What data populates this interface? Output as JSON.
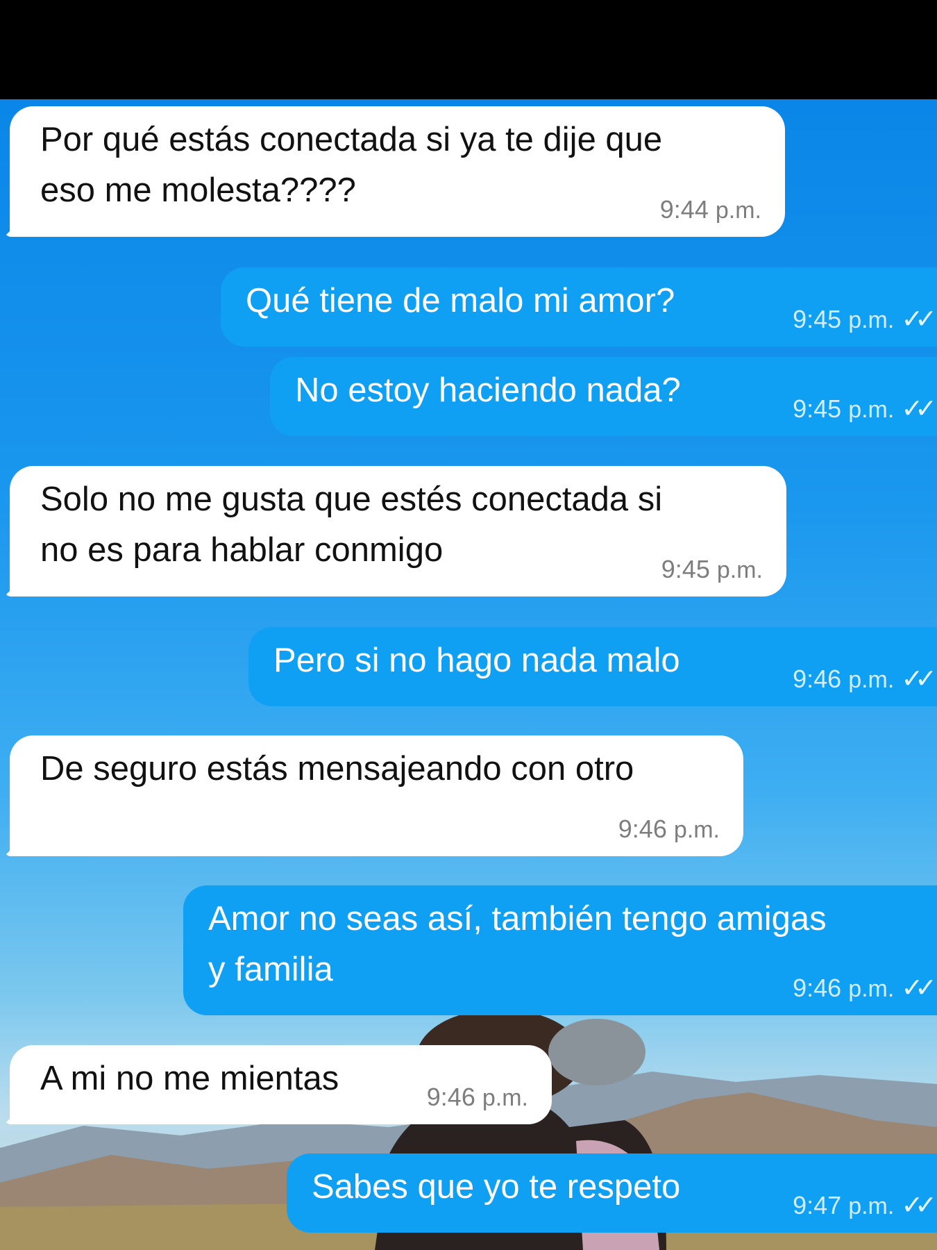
{
  "colors": {
    "incoming_bubble": "#ffffff",
    "outgoing_bubble": "#0fa0f3",
    "wallpaper": "#0a86e8"
  },
  "messages": [
    {
      "direction": "incoming",
      "text_lines": [
        "Por qué estás conectada si ya te dije que",
        "eso me molesta????"
      ],
      "time": "9:44",
      "ampm": "p.m."
    },
    {
      "direction": "outgoing",
      "text_lines": [
        "Qué tiene de malo mi amor?"
      ],
      "time": "9:45",
      "ampm": "p.m.",
      "status_icon": "double-check-icon"
    },
    {
      "direction": "outgoing",
      "text_lines": [
        "No estoy haciendo nada?"
      ],
      "time": "9:45",
      "ampm": "p.m.",
      "status_icon": "double-check-icon"
    },
    {
      "direction": "incoming",
      "text_lines": [
        "Solo no me gusta que estés conectada si",
        "no es para hablar conmigo"
      ],
      "time": "9:45",
      "ampm": "p.m."
    },
    {
      "direction": "outgoing",
      "text_lines": [
        "Pero si no hago nada malo"
      ],
      "time": "9:46",
      "ampm": "p.m.",
      "status_icon": "double-check-icon"
    },
    {
      "direction": "incoming",
      "text_lines": [
        "De seguro estás mensajeando con otro"
      ],
      "time": "9:46",
      "ampm": "p.m."
    },
    {
      "direction": "outgoing",
      "text_lines": [
        "Amor no seas así, también tengo amigas",
        "y familia"
      ],
      "time": "9:46",
      "ampm": "p.m.",
      "status_icon": "double-check-icon"
    },
    {
      "direction": "incoming",
      "text_lines": [
        "A mi no me mientas"
      ],
      "time": "9:46",
      "ampm": "p.m."
    },
    {
      "direction": "outgoing",
      "text_lines": [
        "Sabes que yo te respeto"
      ],
      "time": "9:47",
      "ampm": "p.m.",
      "status_icon": "double-check-icon"
    }
  ]
}
